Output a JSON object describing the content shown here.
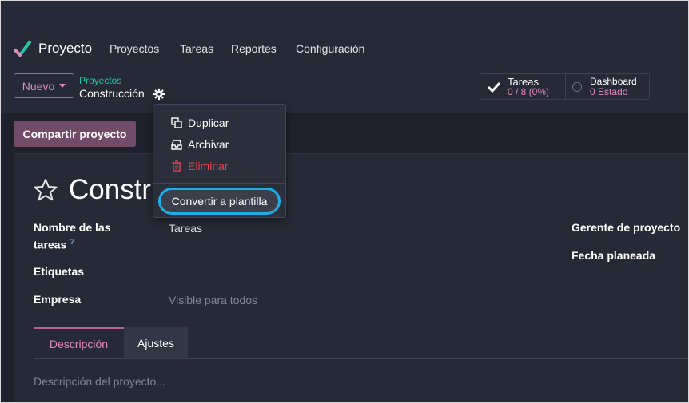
{
  "navbar": {
    "app_name": "Proyecto",
    "menu": [
      "Proyectos",
      "Tareas",
      "Reportes",
      "Configuración"
    ]
  },
  "control_panel": {
    "new_button": "Nuevo",
    "breadcrumb_parent": "Proyectos",
    "breadcrumb_current": "Construcción",
    "stats": {
      "tasks_label": "Tareas",
      "tasks_value": "0 / 8 (0%)",
      "dashboard_label": "Dashboard",
      "dashboard_value": "0 Estado"
    }
  },
  "actions": {
    "share_button": "Compartir proyecto"
  },
  "gear_menu": {
    "duplicate": "Duplicar",
    "archive": "Archivar",
    "delete": "Eliminar",
    "convert_template": "Convertir a plantilla"
  },
  "form": {
    "title_visible": "Constru",
    "fields": {
      "task_name_label_line1": "Nombre de las",
      "task_name_label_line2": "tareas",
      "task_name_help": "?",
      "task_name_value": "Tareas",
      "tags_label": "Etiquetas",
      "company_label": "Empresa",
      "company_placeholder": "Visible para todos",
      "manager_label": "Gerente de proyecto",
      "planned_date_label": "Fecha planeada"
    },
    "tabs": [
      "Descripción",
      "Ajustes"
    ],
    "description_placeholder": "Descripción del proyecto..."
  },
  "colors": {
    "brand": "#714b67",
    "accent_pink": "#e38ab8",
    "accent_teal": "#22c3a6",
    "danger": "#e0434d",
    "highlight": "#1eaee6"
  }
}
